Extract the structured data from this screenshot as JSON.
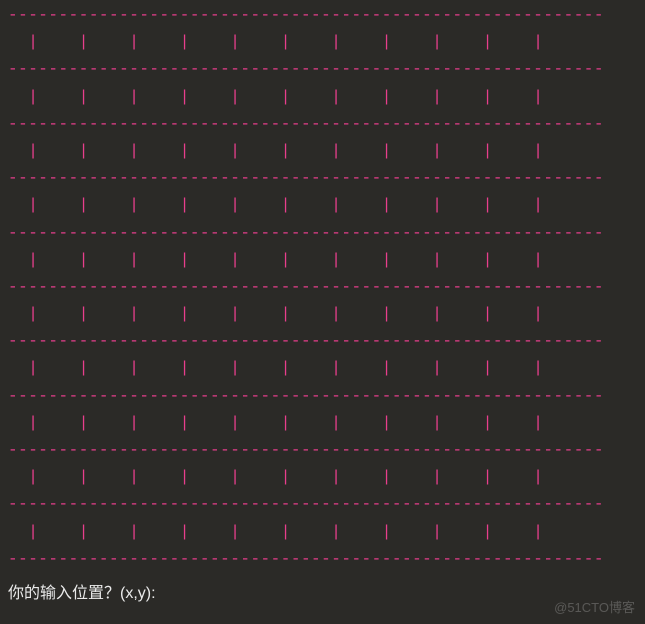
{
  "terminal": {
    "grid_rows": 10,
    "grid_cols": 10,
    "dash_line": "-----------------------------------------------------------",
    "pipe_line": "  |    |    |    |    |    |    |    |    |    |    |",
    "prompt": "你的输入位置？(x,y):"
  },
  "watermark": "@51CTO博客"
}
